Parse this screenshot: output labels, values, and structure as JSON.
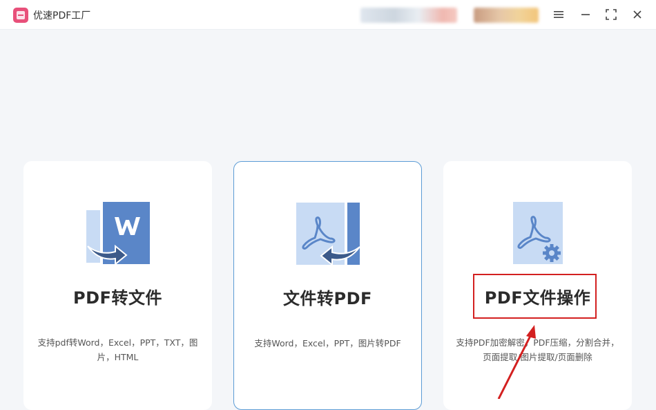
{
  "app": {
    "title": "优速PDF工厂"
  },
  "cards": [
    {
      "title": "PDF转文件",
      "desc": "支持pdf转Word，Excel，PPT，TXT，图片，HTML"
    },
    {
      "title": "文件转PDF",
      "desc": "支持Word，Excel，PPT，图片转PDF"
    },
    {
      "title": "PDF文件操作",
      "desc": "支持PDF加密解密，PDF压缩，分割合并，页面提取/图片提取/页面删除"
    }
  ],
  "colors": {
    "accent": "#5a86c8",
    "light": "#c8dbf4",
    "dark": "#3c5a8a",
    "annotation": "#d32020",
    "logo": "#e8507a"
  },
  "icons": [
    "app-logo-icon",
    "menu-icon",
    "minimize-icon",
    "maximize-icon",
    "close-icon",
    "word-convert-icon",
    "pdf-convert-icon",
    "pdf-settings-icon"
  ]
}
